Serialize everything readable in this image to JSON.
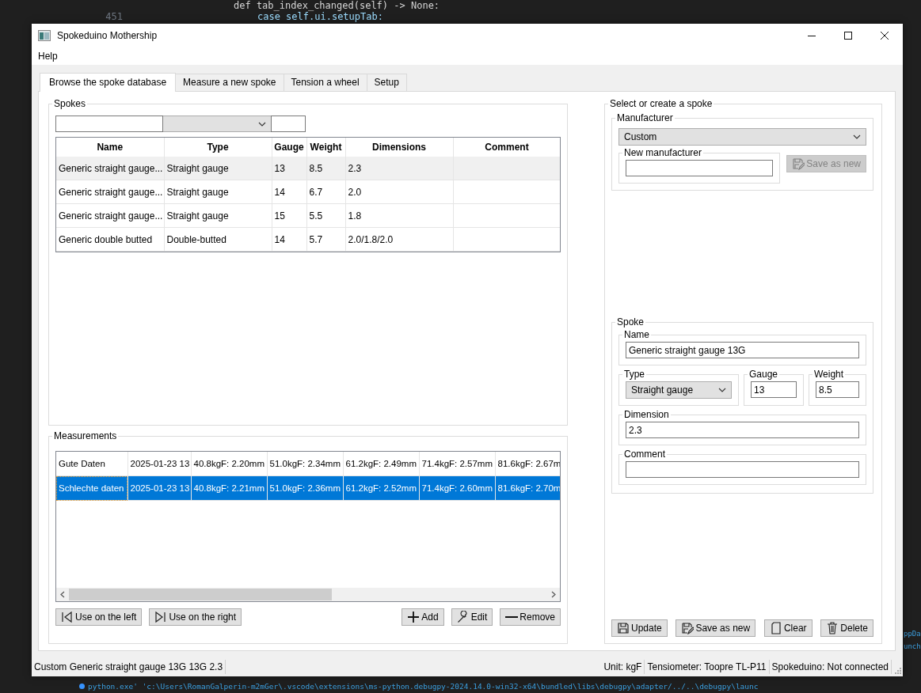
{
  "background": {
    "code_lines": [
      {
        "text": "def tab_index_changed(self) -> None:"
      },
      {
        "number": "451",
        "text": "case self.ui.setupTab:"
      }
    ],
    "terminal_fragments": [
      "ppDa",
      "unch"
    ],
    "terminal_line": "python.exe' 'c:\\Users\\RomanGalperin-m2mGer\\.vscode\\extensions\\ms-python.debugpy-2024.14.0-win32-x64\\bundled\\libs\\debugpy\\adapter/../..\\debugpy\\launc"
  },
  "window": {
    "title": "Spokeduino Mothership"
  },
  "menu": [
    "Help"
  ],
  "tabs": [
    {
      "label": "Browse the spoke database",
      "selected": true
    },
    {
      "label": "Measure a new spoke",
      "selected": false
    },
    {
      "label": "Tension a wheel",
      "selected": false
    },
    {
      "label": "Setup",
      "selected": false
    }
  ],
  "spokes": {
    "title": "Spokes",
    "columns": [
      "Name",
      "Type",
      "Gauge",
      "Weight",
      "Dimensions",
      "Comment"
    ],
    "rows": [
      {
        "cells": [
          "Generic straight gauge...",
          "Straight gauge",
          "13",
          "8.5",
          "2.3",
          ""
        ],
        "selected": true
      },
      {
        "cells": [
          "Generic straight gauge...",
          "Straight gauge",
          "14",
          "6.7",
          "2.0",
          ""
        ],
        "selected": false
      },
      {
        "cells": [
          "Generic straight gauge...",
          "Straight gauge",
          "15",
          "5.5",
          "1.8",
          ""
        ],
        "selected": false
      },
      {
        "cells": [
          "Generic double butted",
          "Double-butted",
          "14",
          "5.7",
          "2.0/1.8/2.0",
          ""
        ],
        "selected": false
      }
    ]
  },
  "measurements": {
    "title": "Measurements",
    "rows": [
      {
        "cells": [
          "Gute Daten",
          "2025-01-23 13",
          "40.8kgF: 2.20mm",
          "51.0kgF: 2.34mm",
          "61.2kgF: 2.49mm",
          "71.4kgF: 2.57mm",
          "81.6kgF: 2.67m"
        ],
        "selected": false
      },
      {
        "cells": [
          "Schlechte daten",
          "2025-01-23 13",
          "40.8kgF: 2.21mm",
          "51.0kgF: 2.36mm",
          "61.2kgF: 2.52mm",
          "71.4kgF: 2.60mm",
          "81.6kgF: 2.70m"
        ],
        "selected": true
      }
    ],
    "buttons": [
      {
        "kind": "use-left",
        "label": "Use on the left",
        "disabled": false
      },
      {
        "kind": "use-right",
        "label": "Use on the right",
        "disabled": false
      },
      {
        "kind": "add",
        "label": "Add",
        "disabled": false
      },
      {
        "kind": "edit",
        "label": "Edit",
        "disabled": false
      },
      {
        "kind": "remove",
        "label": "Remove",
        "disabled": false
      }
    ]
  },
  "editor": {
    "title": "Select or create a spoke",
    "manufacturer": {
      "title": "Manufacturer",
      "value": "Custom",
      "new_title": "New manufacturer",
      "save_button": {
        "kind": "save-as",
        "label": "Save as new",
        "disabled": true
      }
    },
    "spoke": {
      "title": "Spoke",
      "name_label": "Name",
      "name": "Generic straight gauge 13G",
      "type_label": "Type",
      "type": "Straight gauge",
      "gauge_label": "Gauge",
      "gauge": "13",
      "weight_label": "Weight",
      "weight": "8.5",
      "dimension_label": "Dimension",
      "dimension": "2.3",
      "comment_label": "Comment"
    },
    "buttons": [
      {
        "kind": "save",
        "label": "Update",
        "disabled": false
      },
      {
        "kind": "save-as",
        "label": "Save as new",
        "disabled": false
      },
      {
        "kind": "clear",
        "label": "Clear",
        "disabled": false
      },
      {
        "kind": "delete",
        "label": "Delete",
        "disabled": false
      }
    ]
  },
  "status_bar": [
    "Custom Generic straight gauge 13G 13G 2.3",
    "Unit: kgF",
    "Tensiometer: Toopre TL-P11",
    "Spokeduino: Not connected"
  ]
}
